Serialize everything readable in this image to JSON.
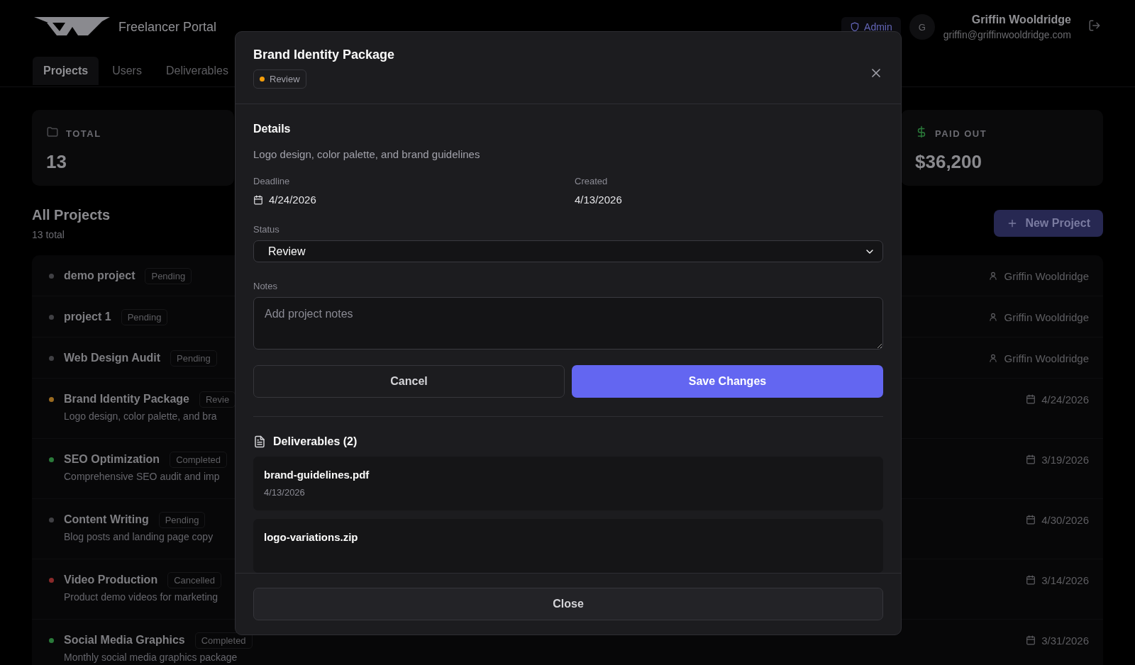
{
  "header": {
    "brand": "Freelancer Portal",
    "role_badge": "Admin",
    "avatar_initial": "G",
    "user_name": "Griffin Wooldridge",
    "user_email": "griffin@griffinwooldridge.com"
  },
  "tabs": [
    {
      "label": "Projects",
      "selected": true
    },
    {
      "label": "Users",
      "selected": false
    },
    {
      "label": "Deliverables",
      "selected": false
    }
  ],
  "stats": [
    {
      "kind": "total",
      "label": "TOTAL",
      "value": "13"
    },
    {
      "kind": "paid",
      "label": "PAID OUT",
      "value": "$36,200"
    }
  ],
  "projects_section": {
    "title": "All Projects",
    "count": "13 total",
    "new_button": "New Project"
  },
  "projects": [
    {
      "name": "demo project",
      "status": "Pending",
      "color": "#404044",
      "kind": "person",
      "meta": "Griffin Wooldridge"
    },
    {
      "name": "project 1",
      "status": "Pending",
      "color": "#404044",
      "kind": "person",
      "meta": "Griffin Wooldridge"
    },
    {
      "name": "Web Design Audit",
      "status": "Pending",
      "color": "#404044",
      "kind": "person",
      "meta": "Griffin Wooldridge"
    },
    {
      "name": "Brand Identity Package",
      "status": "Revie",
      "color": "#9a6a20",
      "description": "Logo design, color palette, and bra",
      "kind": "date",
      "meta": "4/24/2026"
    },
    {
      "name": "SEO Optimization",
      "status": "Completed",
      "color": "#2a7a3a",
      "description": "Comprehensive SEO audit and imp",
      "kind": "date",
      "meta": "3/19/2026"
    },
    {
      "name": "Content Writing",
      "status": "Pending",
      "color": "#404044",
      "description": "Blog posts and landing page copy",
      "kind": "date",
      "meta": "4/30/2026"
    },
    {
      "name": "Video Production",
      "status": "Cancelled",
      "color": "#8a2a2a",
      "description": "Product demo videos for marketing",
      "kind": "date",
      "meta": "3/14/2026"
    },
    {
      "name": "Social Media Graphics",
      "status": "Completed",
      "color": "#2a7a3a",
      "description": "Monthly social media graphics package",
      "kind": "date",
      "meta": "3/31/2026"
    }
  ],
  "modal": {
    "title": "Brand Identity Package",
    "status_badge": {
      "label": "Review",
      "color": "#f59e0b"
    },
    "details_heading": "Details",
    "description": "Logo design, color palette, and brand guidelines",
    "deadline_label": "Deadline",
    "deadline": "4/24/2026",
    "created_label": "Created",
    "created": "4/13/2026",
    "status_label": "Status",
    "status_value": "Review",
    "notes_label": "Notes",
    "notes_placeholder": "Add project notes",
    "cancel": "Cancel",
    "save": "Save Changes",
    "deliverables_heading": "Deliverables (2)",
    "deliverables": [
      {
        "name": "brand-guidelines.pdf",
        "date": "4/13/2026"
      },
      {
        "name": "logo-variations.zip"
      }
    ],
    "close": "Close"
  }
}
